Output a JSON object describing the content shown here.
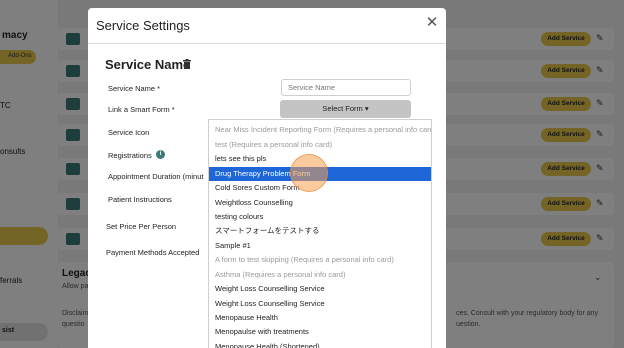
{
  "background": {
    "sidebar_texts": [
      "macy",
      "TC",
      "onsults",
      "ferrals"
    ],
    "addons_label": "Add-Ons",
    "assist_label": "sist",
    "add_service_label": "Add Service",
    "legacy": {
      "title": "Legacy",
      "subtitle": "Allow pa",
      "body_lines": [
        "Disclaim",
        "questio"
      ],
      "right_lines": [
        "ces. Consult with your regulatory body for any",
        "uestion."
      ]
    }
  },
  "modal": {
    "title": "Service Settings",
    "close_icon": "close-icon",
    "section_title": "Service Name",
    "trash_icon": "trash-icon",
    "labels": {
      "service_name": "Service Name *",
      "smart_form": "Link a Smart Form *",
      "service_icon": "Service Icon",
      "registrations": "Registrations",
      "appointment_duration": "Appointment Duration (minut",
      "patient_instructions": "Patient Instructions",
      "set_price": "Set Price Per Person",
      "payment_methods": "Payment Methods Accepted"
    },
    "service_name_placeholder": "Service Name",
    "select_form_label": "Select Form ▾",
    "info_icon_glyph": "i"
  },
  "dropdown": {
    "items": [
      {
        "label": "Near Miss Incident Reporting Form (Requires a personal info card)",
        "disabled": true
      },
      {
        "label": "test (Requires a personal info card)",
        "disabled": true
      },
      {
        "label": "lets see this pls",
        "disabled": false
      },
      {
        "label": "Drug Therapy Problem Form",
        "disabled": false,
        "selected": true
      },
      {
        "label": "Cold Sores Custom Form",
        "disabled": false
      },
      {
        "label": "Weightloss Counselling",
        "disabled": false
      },
      {
        "label": "testing colours",
        "disabled": false
      },
      {
        "label": "スマートフォームをテストする",
        "disabled": false
      },
      {
        "label": "Sample #1",
        "disabled": false
      },
      {
        "label": "A form to test skipping (Requires a personal info card)",
        "disabled": true
      },
      {
        "label": "Asthma (Requires a personal info card)",
        "disabled": true
      },
      {
        "label": "Weight Loss Counselling Service",
        "disabled": false
      },
      {
        "label": "Weight Loss Counselling Service",
        "disabled": false
      },
      {
        "label": "Menopause Health",
        "disabled": false
      },
      {
        "label": "Menopaulse with treatments",
        "disabled": false
      },
      {
        "label": "Menopause Health (Shortened)",
        "disabled": false
      }
    ]
  },
  "colors": {
    "selected_bg": "#1e66d8",
    "accent_yellow": "#e9c84a",
    "teal": "#3d7a7a"
  }
}
